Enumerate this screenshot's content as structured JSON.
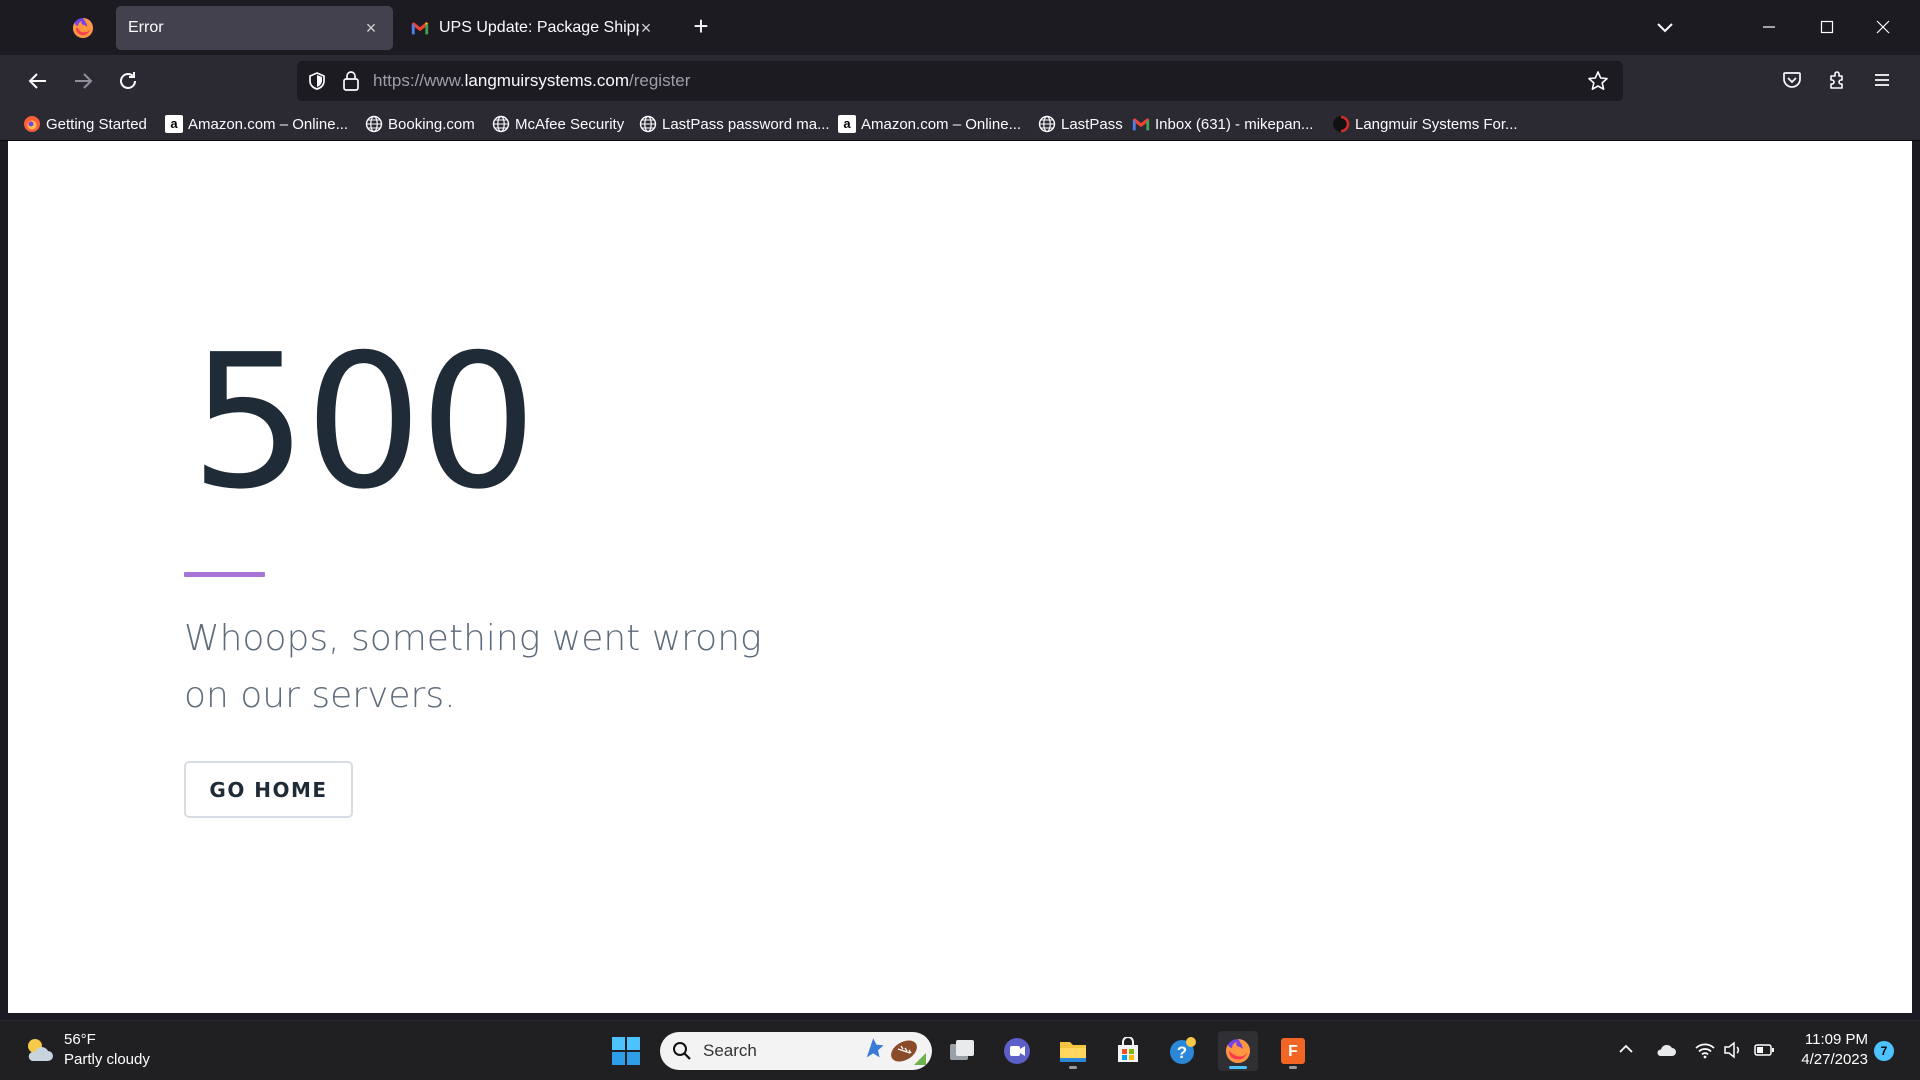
{
  "browser": {
    "tabs": [
      {
        "title": "Error",
        "active": true
      },
      {
        "title": "UPS Update: Package Shipped - mikepan...",
        "active": false
      }
    ],
    "url": {
      "prefix": "https://www.",
      "host": "langmuirsystems.com",
      "path": "/register"
    },
    "bookmarks": [
      {
        "label": "Getting Started",
        "icon": "firefox-icon"
      },
      {
        "label": "Amazon.com – Online...",
        "icon": "amazon-icon"
      },
      {
        "label": "Booking.com",
        "icon": "globe-icon"
      },
      {
        "label": "McAfee Security",
        "icon": "globe-icon"
      },
      {
        "label": "LastPass password ma...",
        "icon": "globe-icon"
      },
      {
        "label": "Amazon.com – Online...",
        "icon": "amazon-icon"
      },
      {
        "label": "LastPass",
        "icon": "globe-icon"
      },
      {
        "label": "Inbox (631) - mikepan...",
        "icon": "gmail-icon"
      },
      {
        "label": "Langmuir Systems For...",
        "icon": "langmuir-icon"
      }
    ]
  },
  "page": {
    "code": "500",
    "message": "Whoops, something went wrong on our servers.",
    "button": "GO HOME",
    "accent": "#a874d8"
  },
  "taskbar": {
    "weather": {
      "temp": "56°F",
      "desc": "Partly cloudy"
    },
    "search_label": "Search",
    "clock": {
      "time": "11:09 PM",
      "date": "4/27/2023"
    },
    "notifications": "7"
  }
}
